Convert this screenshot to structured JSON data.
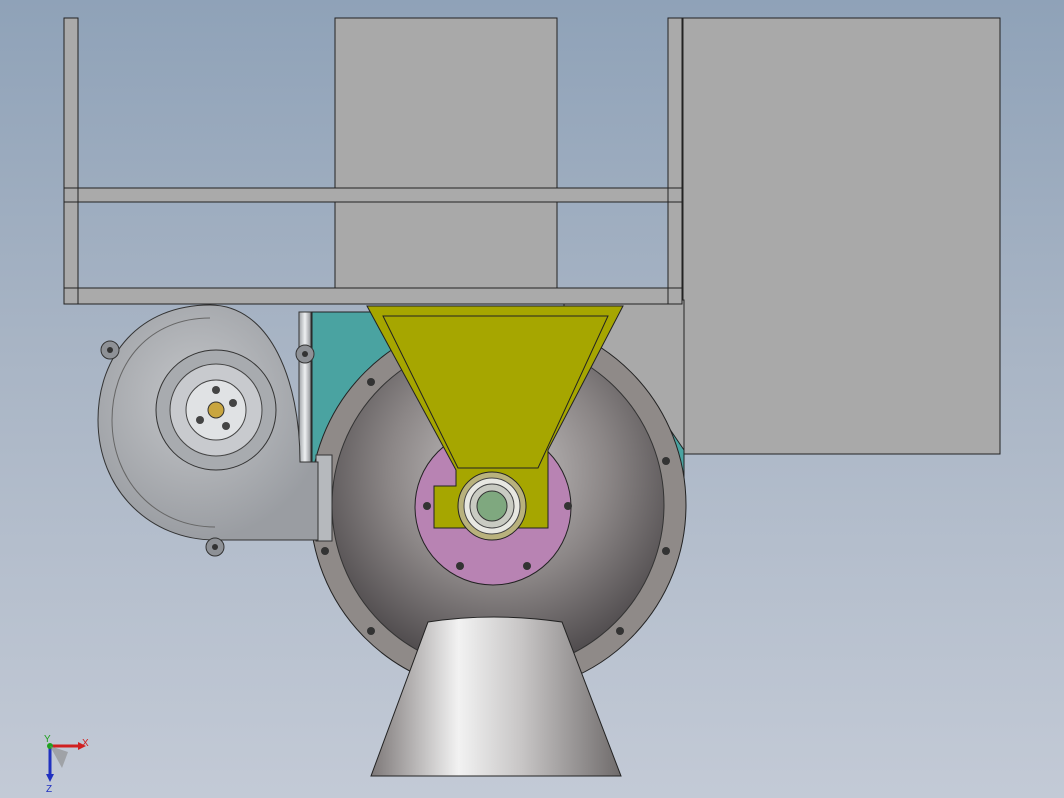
{
  "viewport": {
    "background_top": "#8fa2b8",
    "background_bottom": "#c3cad6"
  },
  "colors": {
    "frame": "#a9a9a9",
    "hopper": "#a6a600",
    "flange": "#b883b3",
    "teal_body": "#4aa3a1",
    "housing_ring": "#8f8a88",
    "bearing": "#7fa87f",
    "outline": "#222222"
  },
  "triad": {
    "x_label": "X",
    "y_label": "Y",
    "z_label": "Z",
    "x_color": "#d02020",
    "y_color": "#20a020",
    "z_color": "#2030c0"
  }
}
